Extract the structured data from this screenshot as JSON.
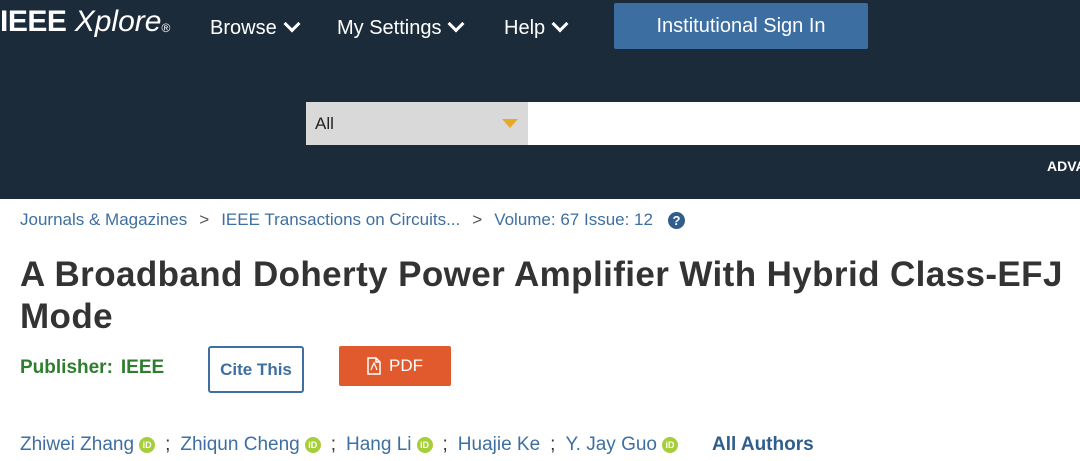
{
  "brand": {
    "name_bold": "IEEE",
    "name_italic": "Xplore",
    "registered": "®"
  },
  "nav": {
    "browse": "Browse",
    "settings": "My Settings",
    "help": "Help",
    "signin": "Institutional Sign In"
  },
  "search": {
    "scope": "All",
    "value": "",
    "advanced_label": "ADVA"
  },
  "breadcrumb": {
    "items": [
      "Journals & Magazines",
      "IEEE Transactions on Circuits...",
      "Volume: 67 Issue: 12"
    ],
    "separator": ">",
    "help_glyph": "?"
  },
  "article": {
    "title": "A Broadband Doherty Power Amplifier With Hybrid Class-EFJ Mode",
    "publisher_label": "Publisher:",
    "publisher": "IEEE",
    "cite_label": "Cite This",
    "pdf_label": "PDF"
  },
  "authors": {
    "list": [
      "Zhiwei Zhang",
      "Zhiqun Cheng",
      "Hang Li",
      "Huajie Ke",
      "Y. Jay Guo"
    ],
    "separator": ";",
    "orcid_glyph": "iD",
    "all_label": "All Authors"
  },
  "colors": {
    "header_bg": "#1c2b3a",
    "link": "#3e6fa0",
    "pdf": "#e15a2d",
    "publisher": "#2f7d2f",
    "orcid": "#a6ce39"
  }
}
